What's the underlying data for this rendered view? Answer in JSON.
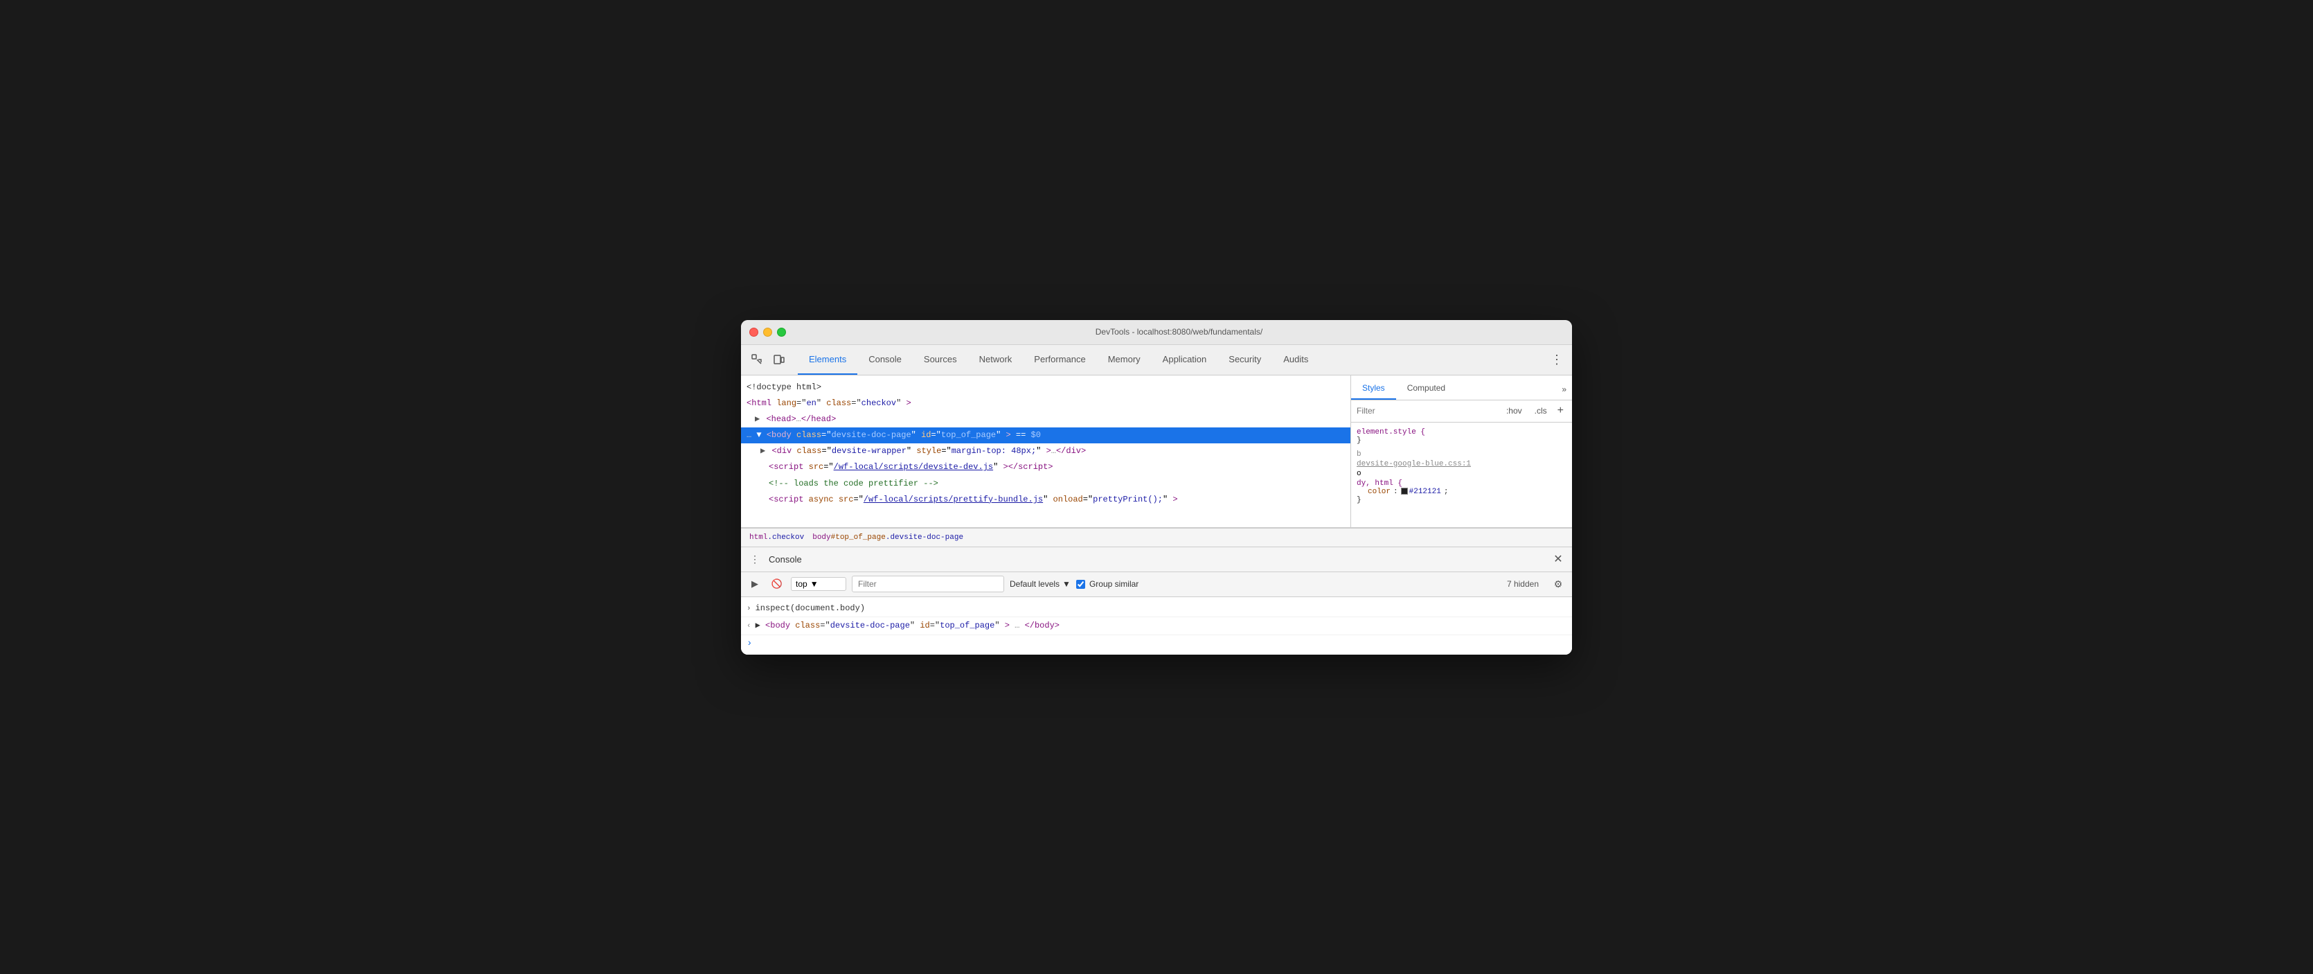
{
  "window": {
    "title": "DevTools - localhost:8080/web/fundamentals/"
  },
  "traffic_lights": {
    "close_label": "close",
    "minimize_label": "minimize",
    "maximize_label": "maximize"
  },
  "tabs": [
    {
      "id": "elements",
      "label": "Elements",
      "active": true
    },
    {
      "id": "console",
      "label": "Console",
      "active": false
    },
    {
      "id": "sources",
      "label": "Sources",
      "active": false
    },
    {
      "id": "network",
      "label": "Network",
      "active": false
    },
    {
      "id": "performance",
      "label": "Performance",
      "active": false
    },
    {
      "id": "memory",
      "label": "Memory",
      "active": false
    },
    {
      "id": "application",
      "label": "Application",
      "active": false
    },
    {
      "id": "security",
      "label": "Security",
      "active": false
    },
    {
      "id": "audits",
      "label": "Audits",
      "active": false
    }
  ],
  "elements_panel": {
    "lines": [
      {
        "id": "doctype",
        "indent": 0,
        "content": "<!doctype html>",
        "selected": false
      },
      {
        "id": "html",
        "indent": 0,
        "content": "<html lang=\"en\" class=\"checkov\">",
        "selected": false
      },
      {
        "id": "head",
        "indent": 1,
        "content": "▶ <head>…</head>",
        "selected": false
      },
      {
        "id": "body",
        "indent": 1,
        "content": "… ▼ <body class=\"devsite-doc-page\" id=\"top_of_page\"> == $0",
        "selected": true
      },
      {
        "id": "div",
        "indent": 2,
        "content": "▶ <div class=\"devsite-wrapper\" style=\"margin-top: 48px;\">…</div>",
        "selected": false
      },
      {
        "id": "script1",
        "indent": 3,
        "content": "<script src=\"/wf-local/scripts/devsite-dev.js\"><\\/script>",
        "selected": false
      },
      {
        "id": "comment",
        "indent": 3,
        "content": "<!-- loads the code prettifier -->",
        "selected": false
      },
      {
        "id": "script2",
        "indent": 3,
        "content": "<script async src=\"/wf-local/scripts/prettify-bundle.js\" onload=\"prettyPrint();\">",
        "selected": false
      }
    ]
  },
  "breadcrumb": {
    "items": [
      {
        "id": "html-crumb",
        "text": "html.checkov"
      },
      {
        "id": "body-crumb",
        "text": "body#top_of_page.devsite-doc-page"
      }
    ]
  },
  "styles_panel": {
    "tabs": [
      {
        "id": "styles",
        "label": "Styles",
        "active": true
      },
      {
        "id": "computed",
        "label": "Computed",
        "active": false
      }
    ],
    "filter_placeholder": "Filter",
    "filter_buttons": [
      ":hov",
      ".cls"
    ],
    "rules": [
      {
        "id": "element-style",
        "selector": "element.style {",
        "close": "}",
        "properties": []
      },
      {
        "id": "body-rule",
        "origin": "devsite-google-blue.css:1",
        "selector_prefix": "b",
        "selector_suffix": "o",
        "selector": "dy, html {",
        "close": "}",
        "properties": [
          {
            "name": "color",
            "value": "#212121",
            "has_swatch": true
          }
        ]
      }
    ]
  },
  "console_section": {
    "title": "Console",
    "toolbar": {
      "context_label": "top",
      "filter_placeholder": "Filter",
      "levels_label": "Default levels",
      "group_similar_label": "Group similar",
      "group_similar_checked": true,
      "hidden_count": "7 hidden"
    },
    "lines": [
      {
        "id": "inspect-line",
        "arrow": "›",
        "arrow_class": "right",
        "text": "inspect(document.body)"
      },
      {
        "id": "body-result",
        "arrow": "‹",
        "arrow_class": "left",
        "text": "▶ <body class=\"devsite-doc-page\" id=\"top_of_page\">…</body>"
      }
    ],
    "prompt_arrow": "›"
  }
}
